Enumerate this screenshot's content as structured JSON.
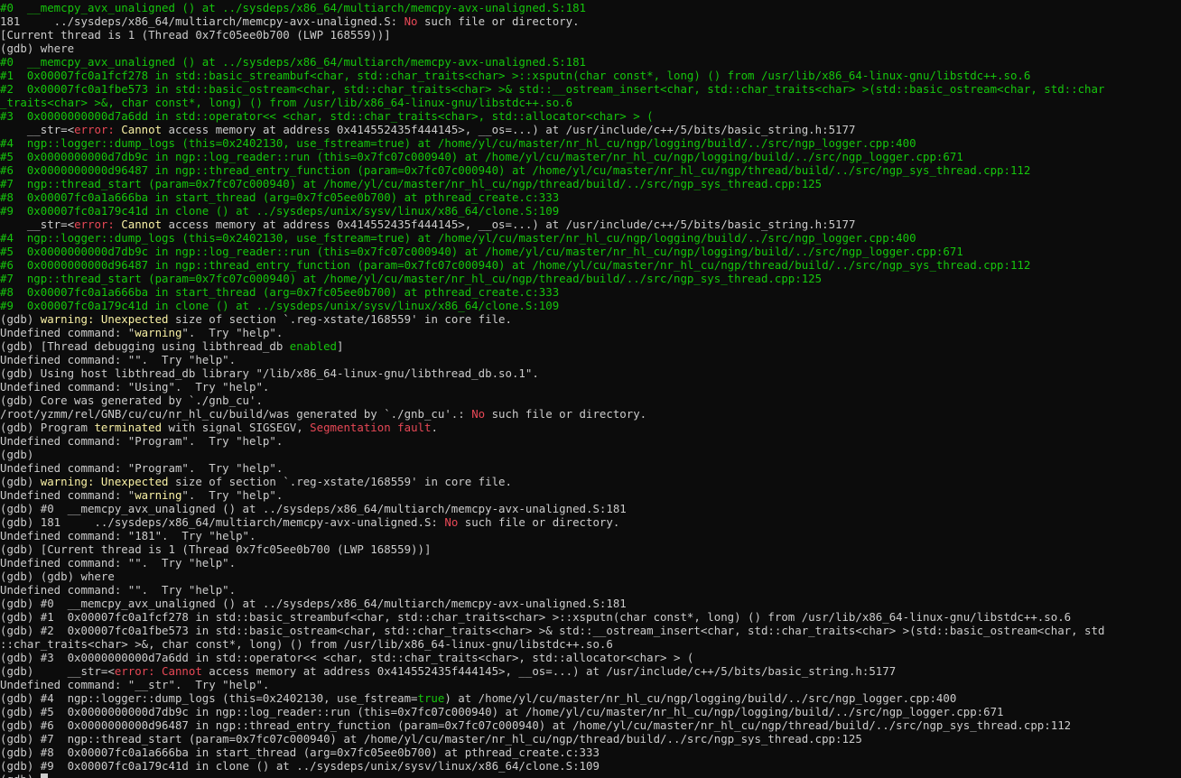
{
  "colors": {
    "background": "#0c0c0c",
    "default": "#cccccc",
    "green": "#16c60c",
    "red": "#e74856",
    "yellow": "#f9f1a5"
  },
  "lines": [
    [
      [
        "g",
        "#0  __memcpy_avx_unaligned () at ../sysdeps/x86_64/multiarch/memcpy-avx-unaligned.S:181"
      ]
    ],
    [
      [
        "w",
        "181     ../sysdeps/x86_64/multiarch/memcpy-avx-unaligned.S: "
      ],
      [
        "r",
        "No"
      ],
      [
        "w",
        " such file or directory."
      ]
    ],
    [
      [
        "w",
        "[Current thread is 1 (Thread 0x7fc05ee0b700 (LWP 168559))]"
      ]
    ],
    [
      [
        "w",
        "(gdb) where"
      ]
    ],
    [
      [
        "g",
        "#0  __memcpy_avx_unaligned () at ../sysdeps/x86_64/multiarch/memcpy-avx-unaligned.S:181"
      ]
    ],
    [
      [
        "g",
        "#1  0x00007fc0a1fcf278 in std::basic_streambuf<char, std::char_traits<char> >::xsputn(char const*, long) () from /usr/lib/x86_64-linux-gnu/libstdc++.so.6"
      ]
    ],
    [
      [
        "g",
        "#2  0x00007fc0a1fbe573 in std::basic_ostream<char, std::char_traits<char> >& std::__ostream_insert<char, std::char_traits<char> >(std::basic_ostream<char, std::char"
      ]
    ],
    [
      [
        "g",
        "_traits<char> >&, char const*, long) () from /usr/lib/x86_64-linux-gnu/libstdc++.so.6"
      ]
    ],
    [
      [
        "g",
        "#3  0x0000000000d7a6dd in std::operator<< <char, std::char_traits<char>, std::allocator<char> > ("
      ]
    ],
    [
      [
        "w",
        "    __str=<"
      ],
      [
        "r",
        "error: "
      ],
      [
        "y",
        "Cannot"
      ],
      [
        "w",
        " access memory at address 0x414552435f444145>, __os=...) at /usr/include/c++/5/bits/basic_string.h:5177"
      ]
    ],
    [
      [
        "g",
        "#4  ngp::logger::dump_logs (this=0x2402130, use_fstream=true) at /home/yl/cu/master/nr_hl_cu/ngp/logging/build/../src/ngp_logger.cpp:400"
      ]
    ],
    [
      [
        "g",
        "#5  0x0000000000d7db9c in ngp::log_reader::run (this=0x7fc07c000940) at /home/yl/cu/master/nr_hl_cu/ngp/logging/build/../src/ngp_logger.cpp:671"
      ]
    ],
    [
      [
        "g",
        "#6  0x0000000000d96487 in ngp::thread_entry_function (param=0x7fc07c000940) at /home/yl/cu/master/nr_hl_cu/ngp/thread/build/../src/ngp_sys_thread.cpp:112"
      ]
    ],
    [
      [
        "g",
        "#7  ngp::thread_start (param=0x7fc07c000940) at /home/yl/cu/master/nr_hl_cu/ngp/thread/build/../src/ngp_sys_thread.cpp:125"
      ]
    ],
    [
      [
        "g",
        "#8  0x00007fc0a1a666ba in start_thread (arg=0x7fc05ee0b700) at pthread_create.c:333"
      ]
    ],
    [
      [
        "g",
        "#9  0x00007fc0a179c41d in clone () at ../sysdeps/unix/sysv/linux/x86_64/clone.S:109"
      ]
    ],
    [
      [
        "w",
        "    __str=<"
      ],
      [
        "r",
        "error: "
      ],
      [
        "y",
        "Cannot"
      ],
      [
        "w",
        " access memory at address 0x414552435f444145>, __os=...) at /usr/include/c++/5/bits/basic_string.h:5177"
      ]
    ],
    [
      [
        "g",
        "#4  ngp::logger::dump_logs (this=0x2402130, use_fstream=true) at /home/yl/cu/master/nr_hl_cu/ngp/logging/build/../src/ngp_logger.cpp:400"
      ]
    ],
    [
      [
        "g",
        "#5  0x0000000000d7db9c in ngp::log_reader::run (this=0x7fc07c000940) at /home/yl/cu/master/nr_hl_cu/ngp/logging/build/../src/ngp_logger.cpp:671"
      ]
    ],
    [
      [
        "g",
        "#6  0x0000000000d96487 in ngp::thread_entry_function (param=0x7fc07c000940) at /home/yl/cu/master/nr_hl_cu/ngp/thread/build/../src/ngp_sys_thread.cpp:112"
      ]
    ],
    [
      [
        "g",
        "#7  ngp::thread_start (param=0x7fc07c000940) at /home/yl/cu/master/nr_hl_cu/ngp/thread/build/../src/ngp_sys_thread.cpp:125"
      ]
    ],
    [
      [
        "g",
        "#8  0x00007fc0a1a666ba in start_thread (arg=0x7fc05ee0b700) at pthread_create.c:333"
      ]
    ],
    [
      [
        "g",
        "#9  0x00007fc0a179c41d in clone () at ../sysdeps/unix/sysv/linux/x86_64/clone.S:109"
      ]
    ],
    [
      [
        "w",
        "(gdb) "
      ],
      [
        "y",
        "warning: Unexpected"
      ],
      [
        "w",
        " size of section `.reg-xstate/168559' in core file."
      ]
    ],
    [
      [
        "w",
        "Undefined command: \""
      ],
      [
        "y",
        "warning"
      ],
      [
        "w",
        "\".  Try \"help\"."
      ]
    ],
    [
      [
        "w",
        "(gdb) [Thread debugging using libthread_db "
      ],
      [
        "g",
        "enabled"
      ],
      [
        "w",
        "]"
      ]
    ],
    [
      [
        "w",
        "Undefined command: \"\".  Try \"help\"."
      ]
    ],
    [
      [
        "w",
        "(gdb) Using host libthread_db library \"/lib/x86_64-linux-gnu/libthread_db.so.1\"."
      ]
    ],
    [
      [
        "w",
        "Undefined command: \"Using\".  Try \"help\"."
      ]
    ],
    [
      [
        "w",
        "(gdb) Core was generated by `./gnb_cu'."
      ]
    ],
    [
      [
        "w",
        "/root/yzmm/rel/GNB/cu/cu/nr_hl_cu/build/was generated by `./gnb_cu'.: "
      ],
      [
        "r",
        "No"
      ],
      [
        "w",
        " such file or directory."
      ]
    ],
    [
      [
        "w",
        "(gdb) Program "
      ],
      [
        "y",
        "terminated"
      ],
      [
        "w",
        " with signal SIGSEGV, "
      ],
      [
        "r",
        "Segmentation fault"
      ],
      [
        "w",
        "."
      ]
    ],
    [
      [
        "w",
        "Undefined command: \"Program\".  Try \"help\"."
      ]
    ],
    [
      [
        "w",
        "(gdb)"
      ]
    ],
    [
      [
        "w",
        "Undefined command: \"Program\".  Try \"help\"."
      ]
    ],
    [
      [
        "w",
        "(gdb) "
      ],
      [
        "y",
        "warning: Unexpected"
      ],
      [
        "w",
        " size of section `.reg-xstate/168559' in core file."
      ]
    ],
    [
      [
        "w",
        "Undefined command: \""
      ],
      [
        "y",
        "warning"
      ],
      [
        "w",
        "\".  Try \"help\"."
      ]
    ],
    [
      [
        "w",
        "(gdb) #0  __memcpy_avx_unaligned () at ../sysdeps/x86_64/multiarch/memcpy-avx-unaligned.S:181"
      ]
    ],
    [
      [
        "w",
        "(gdb) 181     ../sysdeps/x86_64/multiarch/memcpy-avx-unaligned.S: "
      ],
      [
        "r",
        "No"
      ],
      [
        "w",
        " such file or directory."
      ]
    ],
    [
      [
        "w",
        "Undefined command: \"181\".  Try \"help\"."
      ]
    ],
    [
      [
        "w",
        "(gdb) [Current thread is 1 (Thread 0x7fc05ee0b700 (LWP 168559))]"
      ]
    ],
    [
      [
        "w",
        "Undefined command: \"\".  Try \"help\"."
      ]
    ],
    [
      [
        "w",
        "(gdb) (gdb) where"
      ]
    ],
    [
      [
        "w",
        "Undefined command: \"\".  Try \"help\"."
      ]
    ],
    [
      [
        "w",
        "(gdb) #0  __memcpy_avx_unaligned () at ../sysdeps/x86_64/multiarch/memcpy-avx-unaligned.S:181"
      ]
    ],
    [
      [
        "w",
        "(gdb) #1  0x00007fc0a1fcf278 in std::basic_streambuf<char, std::char_traits<char> >::xsputn(char const*, long) () from /usr/lib/x86_64-linux-gnu/libstdc++.so.6"
      ]
    ],
    [
      [
        "w",
        "(gdb) #2  0x00007fc0a1fbe573 in std::basic_ostream<char, std::char_traits<char> >& std::__ostream_insert<char, std::char_traits<char> >(std::basic_ostream<char, std"
      ]
    ],
    [
      [
        "w",
        "::char_traits<char> >&, char const*, long) () from /usr/lib/x86_64-linux-gnu/libstdc++.so.6"
      ]
    ],
    [
      [
        "w",
        "(gdb) #3  0x0000000000d7a6dd in std::operator<< <char, std::char_traits<char>, std::allocator<char> > ("
      ]
    ],
    [
      [
        "w",
        "(gdb)     __str=<"
      ],
      [
        "r",
        "error: Cannot"
      ],
      [
        "w",
        " access memory at address 0x414552435f444145>, __os=...) at /usr/include/c++/5/bits/basic_string.h:5177"
      ]
    ],
    [
      [
        "w",
        "Undefined command: \"__str\".  Try \"help\"."
      ]
    ],
    [
      [
        "w",
        "(gdb) #4  ngp::logger::dump_logs (this=0x2402130, use_fstream="
      ],
      [
        "g",
        "true"
      ],
      [
        "w",
        ") at /home/yl/cu/master/nr_hl_cu/ngp/logging/build/../src/ngp_logger.cpp:400"
      ]
    ],
    [
      [
        "w",
        "(gdb) #5  0x0000000000d7db9c in ngp::log_reader::run (this=0x7fc07c000940) at /home/yl/cu/master/nr_hl_cu/ngp/logging/build/../src/ngp_logger.cpp:671"
      ]
    ],
    [
      [
        "w",
        "(gdb) #6  0x0000000000d96487 in ngp::thread_entry_function (param=0x7fc07c000940) at /home/yl/cu/master/nr_hl_cu/ngp/thread/build/../src/ngp_sys_thread.cpp:112"
      ]
    ],
    [
      [
        "w",
        "(gdb) #7  ngp::thread_start (param=0x7fc07c000940) at /home/yl/cu/master/nr_hl_cu/ngp/thread/build/../src/ngp_sys_thread.cpp:125"
      ]
    ],
    [
      [
        "w",
        "(gdb) #8  0x00007fc0a1a666ba in start_thread (arg=0x7fc05ee0b700) at pthread_create.c:333"
      ]
    ],
    [
      [
        "w",
        "(gdb) #9  0x00007fc0a179c41d in clone () at ../sysdeps/unix/sysv/linux/x86_64/clone.S:109"
      ]
    ],
    [
      [
        "w",
        "(gdb) "
      ]
    ]
  ]
}
